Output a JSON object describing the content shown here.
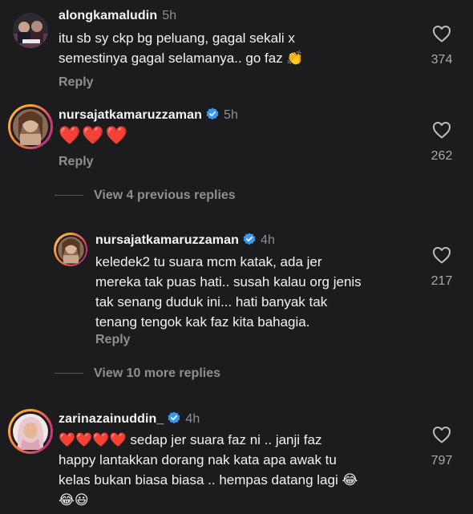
{
  "comments": [
    {
      "username": "alongkamaludin",
      "time": "5h",
      "text_lines": [
        "itu sb sy ckp bg peluang, gagal sekali x",
        "semestinya gagal selamanya.. go faz 👏"
      ],
      "reply_label": "Reply",
      "likes": "374"
    },
    {
      "username": "nursajatkamaruzzaman",
      "time": "5h",
      "text_lines": [
        "❤️❤️❤️"
      ],
      "reply_label": "Reply",
      "likes": "262",
      "verified": true
    }
  ],
  "view_previous": "View 4 previous replies",
  "reply": {
    "username": "nursajatkamaruzzaman",
    "time": "4h",
    "text_lines": [
      "keledek2 tu suara mcm katak, ada jer",
      "mereka tak puas hati.. susah kalau org jenis",
      "tak senang duduk ini... hati banyak tak",
      "tenang tengok kak faz kita bahagia."
    ],
    "reply_label": "Reply",
    "likes": "217",
    "verified": true
  },
  "view_more": "View 10 more replies",
  "comment3": {
    "username": "zarinazainuddin_",
    "time": "4h",
    "text_lines": [
      "❤️❤️❤️❤️ sedap jer suara faz ni .. janji faz",
      "happy lantakkan dorang nak kata apa awak tu",
      "kelas bukan biasa biasa .. hempas datang lagi 😂",
      "😂😃"
    ],
    "likes": "797",
    "verified": true
  },
  "colors": {
    "background": "#1c1c1e",
    "verified_blue": "#3897f0",
    "muted_text": "#8e8e93"
  }
}
